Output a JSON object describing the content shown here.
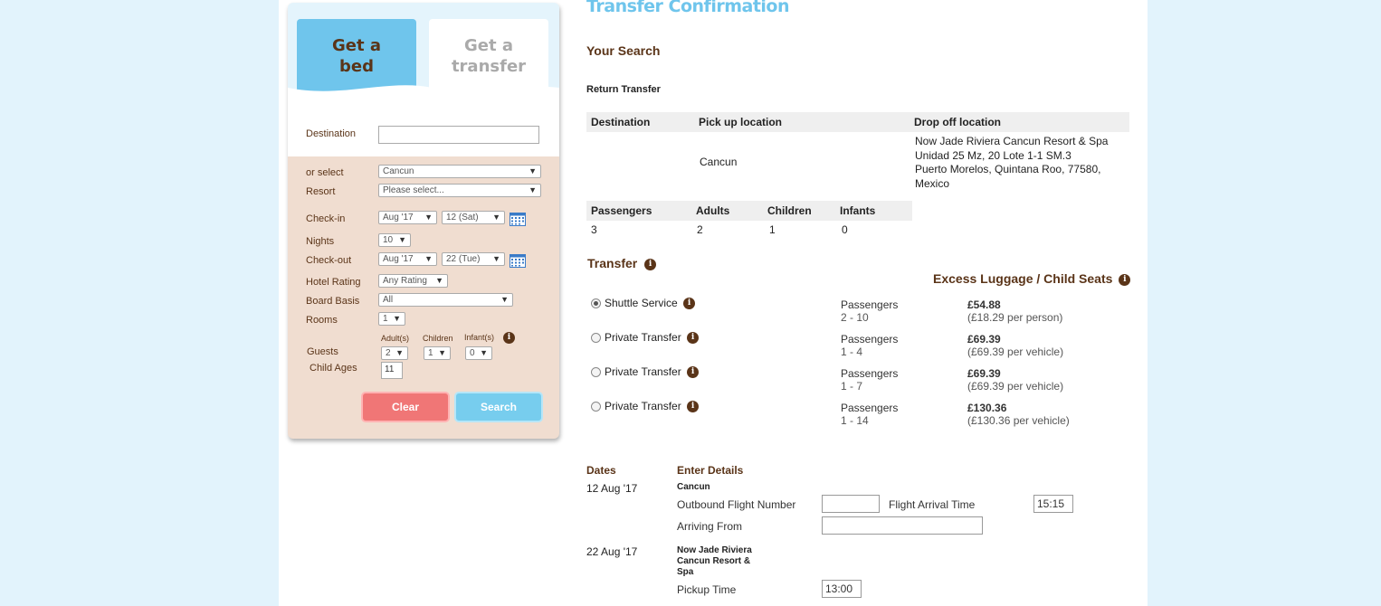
{
  "sidebar": {
    "tab_bed": "Get a bed",
    "tab_transfer": "Get a transfer",
    "destination_label": "Destination",
    "destination_value": "",
    "or_select_label": "or select",
    "or_select_value": "Cancun",
    "resort_label": "Resort",
    "resort_value": "Please select...",
    "checkin_label": "Check-in",
    "checkin_month": "Aug '17",
    "checkin_day": "12 (Sat)",
    "nights_label": "Nights",
    "nights_value": "10",
    "checkout_label": "Check-out",
    "checkout_month": "Aug '17",
    "checkout_day": "22 (Tue)",
    "hotel_rating_label": "Hotel Rating",
    "hotel_rating_value": "Any Rating",
    "board_basis_label": "Board Basis",
    "board_basis_value": "All",
    "rooms_label": "Rooms",
    "rooms_value": "1",
    "adults_label": "Adult(s)",
    "children_label": "Children",
    "infants_label": "Infant(s)",
    "guests_label": "Guests",
    "adults_value": "2",
    "children_value": "1",
    "infants_value": "0",
    "child_ages_label": "Child Ages",
    "child_age_value": "11",
    "clear_label": "Clear",
    "search_label": "Search"
  },
  "main": {
    "title": "Transfer Confirmation",
    "your_search": "Your Search",
    "return_transfer": "Return Transfer",
    "loc_headers": [
      "Destination",
      "Pick up location",
      "Drop off location"
    ],
    "pickup": "Cancun",
    "dropoff_lines": [
      "Now Jade Riviera Cancun Resort & Spa",
      "Unidad 25 Mz, 20 Lote 1-1 SM.3",
      "Puerto Morelos, Quintana Roo, 77580,",
      "Mexico"
    ],
    "pax_headers": [
      "Passengers",
      "Adults",
      "Children",
      "Infants"
    ],
    "pax_values": [
      "3",
      "2",
      "1",
      "0"
    ],
    "transfer_heading": "Transfer",
    "excess_heading": "Excess Luggage / Child Seats",
    "options": [
      {
        "name": "Shuttle Service",
        "pax_label": "Passengers",
        "pax_range": "2 - 10",
        "price": "£54.88",
        "per": "(£18.29 per person)",
        "selected": true
      },
      {
        "name": "Private Transfer",
        "pax_label": "Passengers",
        "pax_range": "1 - 4",
        "price": "£69.39",
        "per": "(£69.39 per vehicle)",
        "selected": false
      },
      {
        "name": "Private Transfer",
        "pax_label": "Passengers",
        "pax_range": "1 - 7",
        "price": "£69.39",
        "per": "(£69.39 per vehicle)",
        "selected": false
      },
      {
        "name": "Private Transfer",
        "pax_label": "Passengers",
        "pax_range": "1 - 14",
        "price": "£130.36",
        "per": "(£130.36 per vehicle)",
        "selected": false
      }
    ],
    "dates_heading": "Dates",
    "details_heading": "Enter Details",
    "outbound_date": "12 Aug '17",
    "outbound_place": "Cancun",
    "outbound_flight_label": "Outbound Flight Number",
    "flight_arrival_label": "Flight Arrival Time",
    "flight_arrival_value": "15:15",
    "arriving_from_label": "Arriving From",
    "return_date": "22 Aug '17",
    "return_place": "Now Jade Riviera Cancun Resort & Spa",
    "pickup_time_label": "Pickup Time",
    "pickup_time_value": "13:00"
  },
  "colors": {
    "brown": "#5a3418",
    "blue": "#6fc5ec",
    "clear": "#f07676",
    "sidebar_bg": "#f0ddd0"
  }
}
